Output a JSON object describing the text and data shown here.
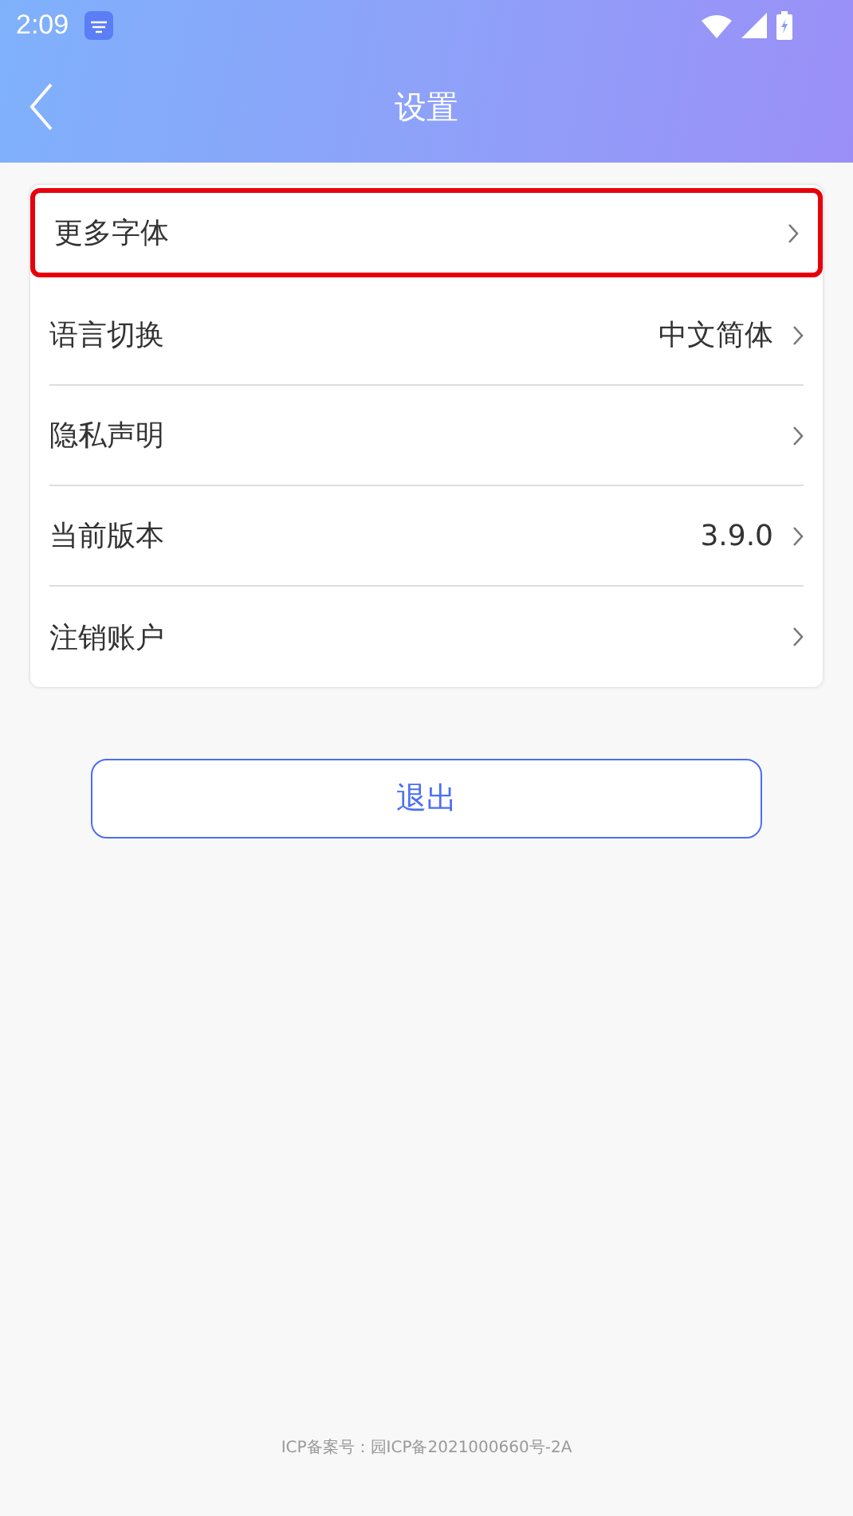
{
  "status_bar": {
    "time": "2:09"
  },
  "header": {
    "title": "设置"
  },
  "settings": [
    {
      "label": "更多字体",
      "highlighted": true
    },
    {
      "label": "语言切换",
      "value": "中文简体",
      "highlighted": false
    },
    {
      "label": "隐私声明",
      "highlighted": false
    },
    {
      "label": "当前版本",
      "value": "3.9.0",
      "highlighted": false
    },
    {
      "label": "注销账户",
      "highlighted": false
    }
  ],
  "logout_button": "退出",
  "footer": "ICP备案号：园ICP备2021000660号-2A"
}
